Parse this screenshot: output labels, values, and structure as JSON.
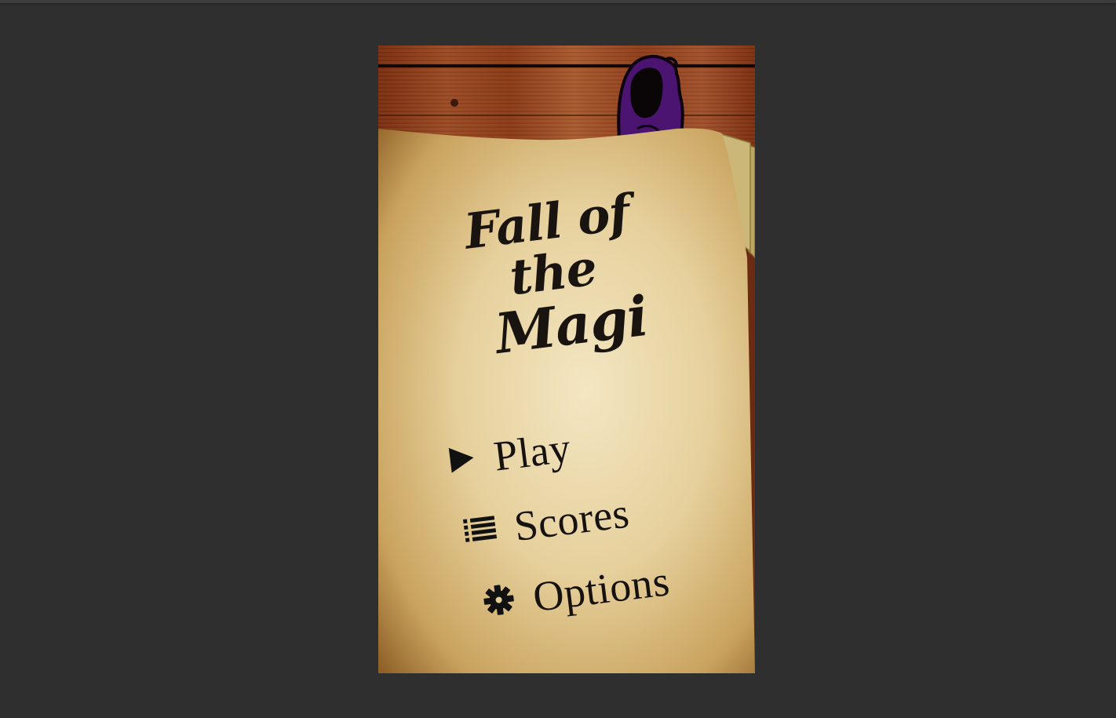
{
  "game": {
    "title_line1": "Fall of the",
    "title_line2": "Magi"
  },
  "menu": {
    "items": [
      {
        "label": "Play",
        "icon": "play-icon"
      },
      {
        "label": "Scores",
        "icon": "list-icon"
      },
      {
        "label": "Options",
        "icon": "gear-icon"
      }
    ]
  },
  "colors": {
    "background": "#2f2f2f",
    "wood": "#8b3a16",
    "paper": "#e6d3a0",
    "ink": "#161210",
    "hood": "#4a1470"
  }
}
